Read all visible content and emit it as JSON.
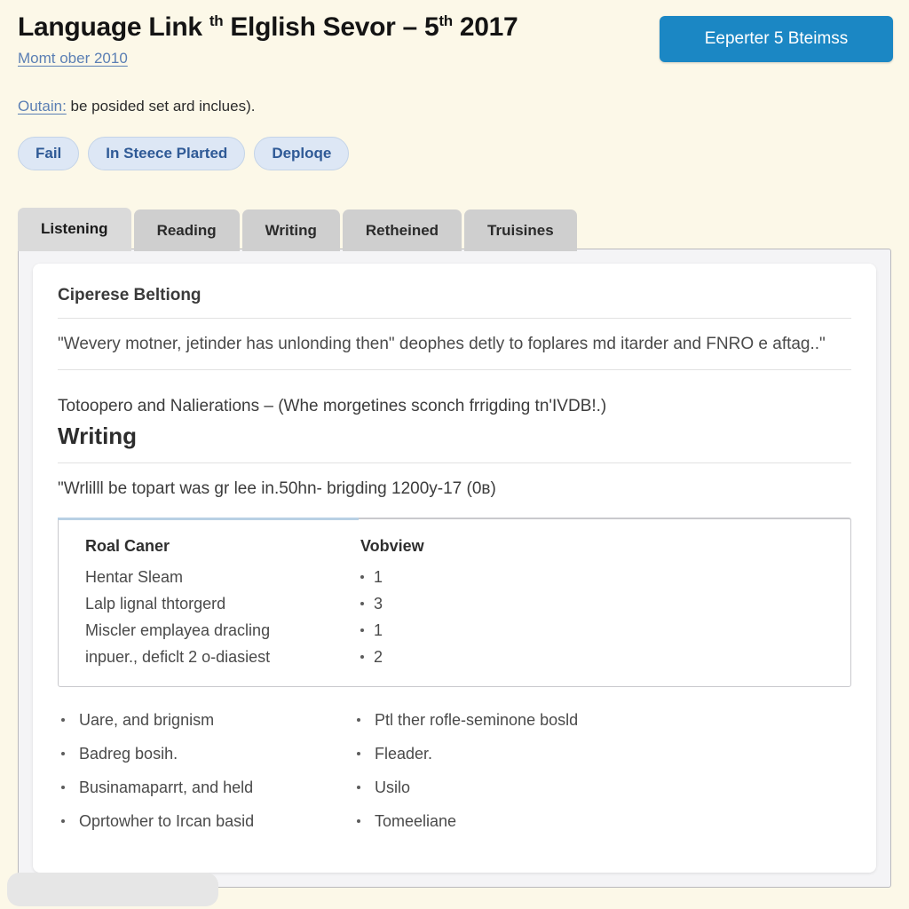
{
  "header": {
    "title_main": "Language Link",
    "title_sup1": "th",
    "title_mid": "Elglish  Sevor – 5",
    "title_sup2": "th",
    "title_year": "2017",
    "subtitle_link": "Momt ober 2010",
    "primary_button": "Eeperter 5 Bteimss",
    "notice_link": "Outain:",
    "notice_text": "be posided set ard inclues).",
    "pills": [
      {
        "label": "Fail"
      },
      {
        "label": "In Steece Plarted"
      },
      {
        "label": "Deploqe"
      }
    ]
  },
  "tabs": [
    {
      "label": "Listening",
      "active": true
    },
    {
      "label": "Reading",
      "active": false
    },
    {
      "label": "Writing",
      "active": false
    },
    {
      "label": "Retheined",
      "active": false
    },
    {
      "label": "Truisines",
      "active": false
    }
  ],
  "main": {
    "section1_heading": "Ciperese Beltiong",
    "section1_paragraph": "\"Wevery motner, jetinder has unlonding then\" deophes detly to foplares md itarder and FNRO e aftag..\"",
    "section1_note": "Totoopero and Nalierations – (Whe morgetines sconch frrigding tn'IVDB!.)",
    "section2_heading": "Writing",
    "section2_quote": "\"Wrlilll be topart was gr lee in.50hn- brigding 1200y-17 (0в)",
    "data_box": {
      "col1_header": "Roal Caner",
      "col2_header": "Vobview",
      "rows": [
        {
          "label": "Hentar Sleam",
          "value": "1"
        },
        {
          "label": "Lalp lignal thtorgerd",
          "value": "3"
        },
        {
          "label": "Miscler emplayea dracling",
          "value": "1"
        },
        {
          "label": "inpuer., deficlt 2 o-diasiest",
          "value": "2"
        }
      ]
    },
    "bullets_left": [
      "Uare, and brignism",
      "Badreg bosih.",
      "Businamaparrt, and held",
      "Oprtowher to Ircan basid"
    ],
    "bullets_right": [
      "Ptl ther rofle-seminone bosld",
      "Fleader.",
      "Usilo",
      "Tomeeliane"
    ]
  },
  "colors": {
    "page_background": "#fcf8e8",
    "primary_button": "#1b87c4",
    "link": "#5b7fb4",
    "pill_background": "#dde7f5",
    "pill_text": "#2f5a96",
    "tab_inactive": "#cfcfcf",
    "tab_active": "#dadada",
    "panel_background": "#f4f4f6",
    "accent_bar": "#b8d0e4"
  }
}
